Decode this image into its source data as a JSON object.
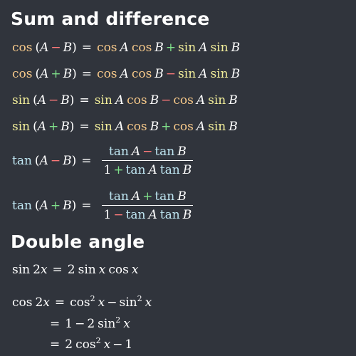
{
  "sections": {
    "sum_diff_title": "Sum and difference",
    "double_angle_title": "Double angle"
  },
  "tokens": {
    "cos": "cos",
    "sin": "sin",
    "tan": "tan",
    "A": "A",
    "B": "B",
    "x": "x",
    "eq": "=",
    "minus": "−",
    "plus": "+",
    "lparen": "(",
    "rparen": ")",
    "one": "1",
    "two": "2",
    "sq": "2",
    "two_x": "2x"
  },
  "colors": {
    "background": "#30343c",
    "cos": "#f7c98a",
    "sin": "#f2ee9a",
    "tan": "#bfe6f2",
    "minus_accent": "#ff7a7a",
    "plus_accent": "#7fe08a",
    "text": "#ffffff"
  }
}
